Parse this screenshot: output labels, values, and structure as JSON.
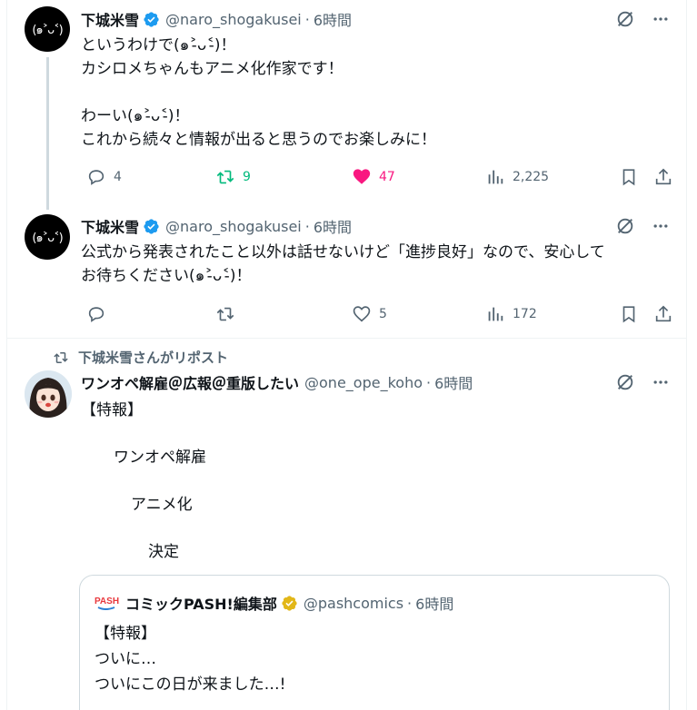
{
  "tweet1": {
    "avatar_text": "(๑˃ᴗ˂)",
    "name": "下城米雪",
    "handle": "@naro_shogakusei",
    "dot": "·",
    "time": "6時間",
    "text": "というわけで(๑˃̵ᴗ˂̵)！\nカシロメちゃんもアニメ化作家です！\n\nわーい(๑˃̵ᴗ˂̵)！\nこれから続々と情報が出ると思うのでお楽しみに！",
    "replies": "4",
    "reposts": "9",
    "likes": "47",
    "views": "2,225"
  },
  "tweet2": {
    "avatar_text": "(๑˃ᴗ˂)",
    "name": "下城米雪",
    "handle": "@naro_shogakusei",
    "dot": "·",
    "time": "6時間",
    "text": "公式から発表されたこと以外は話せないけど「進捗良好」なので、安心して\nお待ちください(๑˃̵ᴗ˂̵)！",
    "replies": "",
    "reposts": "",
    "likes": "5",
    "views": "172"
  },
  "repost_label": "下城米雪さんがリポスト",
  "tweet3": {
    "name": "ワンオペ解雇＠広報＠重版したい",
    "handle": "@one_ope_koho",
    "dot": "·",
    "time": "6時間",
    "line1": "【特報】",
    "line2": "ワンオペ解雇",
    "line3": "アニメ化",
    "line4": "決定"
  },
  "quote": {
    "logo_text": "PASH!",
    "name": "コミックPASH!編集部",
    "handle": "@pashcomics",
    "dot": "·",
    "time": "6時間",
    "text": "【特報】\nついに…\nついにこの日が来ました…!"
  },
  "colors": {
    "verified_blue": "#1d9bf0",
    "verified_gold": "#e2b719",
    "repost_green": "#00ba7c",
    "like_pink": "#f91880",
    "muted": "#536471"
  }
}
